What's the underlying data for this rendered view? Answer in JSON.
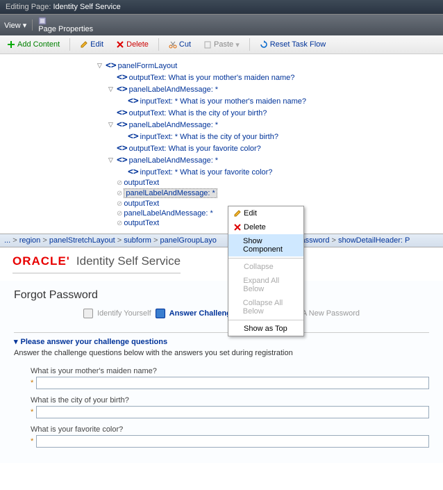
{
  "titlebar": {
    "label": "Editing Page: ",
    "value": "Identity Self Service"
  },
  "menubar": {
    "view": "View",
    "pageProps": "Page Properties"
  },
  "toolbar": {
    "add": "Add Content",
    "edit": "Edit",
    "delete": "Delete",
    "cut": "Cut",
    "paste": "Paste",
    "reset": "Reset Task Flow"
  },
  "tree": {
    "n0": "panelFormLayout",
    "n1": "outputText: What is your mother's maiden name?",
    "n2": "panelLabelAndMessage: *",
    "n3": "inputText: * What is your mother's maiden name?",
    "n4": "outputText: What is the city of your birth?",
    "n5": "panelLabelAndMessage: *",
    "n6": "inputText: * What is the city of your birth?",
    "n7": "outputText: What is your favorite color?",
    "n8": "panelLabelAndMessage: *",
    "n9": "inputText: * What is your favorite color?",
    "n10": "outputText",
    "n11": "panelLabelAndMessage: *",
    "n12": "outputText",
    "n13": "panelLabelAndMessage: *",
    "n14": "outputText"
  },
  "ctx": {
    "edit": "Edit",
    "delete": "Delete",
    "show": "Show Component",
    "collapse": "Collapse",
    "expandAll": "Expand All Below",
    "collapseAll": "Collapse All Below",
    "showTop": "Show as Top"
  },
  "breadcrumb": {
    "pre": "...",
    "b0": "region",
    "b1": "panelStretchLayout",
    "b2": "subform",
    "b3": "panelGroupLayo",
    "b4": "Forgot Password",
    "b5": "showDetailHeader: P"
  },
  "oracle": {
    "logo": "ORACLE'",
    "sub": "Identity Self Service"
  },
  "page": {
    "title": "Forgot Password",
    "step1": "Identify Yourself",
    "step2": "Answer Challenge Questions",
    "step3": "Select A New Password",
    "secTitle": "Please answer your challenge questions",
    "secDesc": "Answer the challenge questions below with the answers you set during registration",
    "q1": "What is your mother's maiden name?",
    "q2": "What is the city of your birth?",
    "q3": "What is your favorite color?",
    "star": "*"
  }
}
